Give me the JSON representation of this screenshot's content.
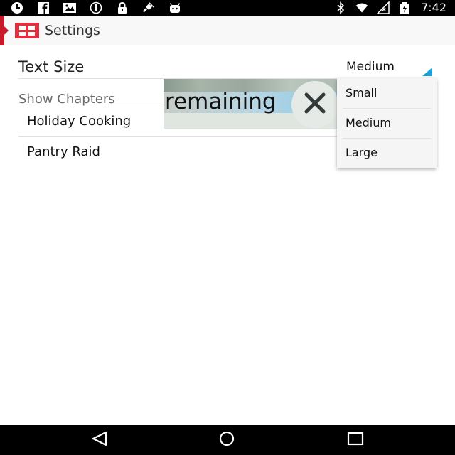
{
  "status_bar": {
    "time": "7:42",
    "left_icons": [
      "clock-icon",
      "facebook-icon",
      "photos-icon",
      "info-icon",
      "lock-icon",
      "satellite-icon",
      "android-icon"
    ],
    "right_icons": [
      "bluetooth-icon",
      "wifi-icon",
      "signal-icon",
      "battery-charging-icon"
    ]
  },
  "action_bar": {
    "title": "Settings",
    "accent_color": "#c61a2a"
  },
  "settings": {
    "text_size_label": "Text Size",
    "text_size_value": "Medium",
    "section_header": "Show Chapters",
    "chapters": [
      "Holiday Cooking",
      "Pantry Raid"
    ]
  },
  "dropdown": {
    "options": [
      "Small",
      "Medium",
      "Large"
    ]
  },
  "overlay": {
    "text": "remaining"
  },
  "colors": {
    "spinner_accent": "#1ba1d8"
  },
  "nav_bar": {
    "buttons": [
      "back-icon",
      "home-icon",
      "recents-icon"
    ]
  }
}
